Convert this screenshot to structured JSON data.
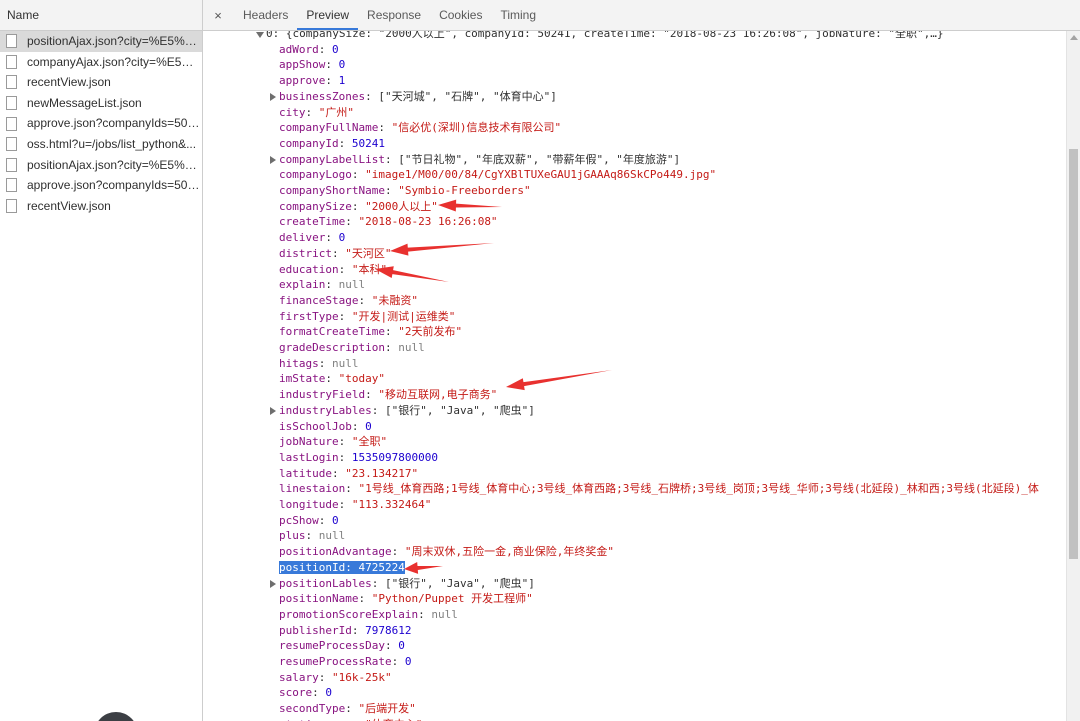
{
  "left_panel": {
    "header": "Name",
    "files": [
      {
        "name": "positionAjax.json?city=%E5%B...",
        "selected": true
      },
      {
        "name": "companyAjax.json?city=%E5%..."
      },
      {
        "name": "recentView.json"
      },
      {
        "name": "newMessageList.json"
      },
      {
        "name": "approve.json?companyIds=502..."
      },
      {
        "name": "oss.html?u=/jobs/list_python&..."
      },
      {
        "name": "positionAjax.json?city=%E5%B..."
      },
      {
        "name": "approve.json?companyIds=502..."
      },
      {
        "name": "recentView.json"
      }
    ]
  },
  "tabs": {
    "close": "×",
    "items": [
      {
        "label": "Headers"
      },
      {
        "label": "Preview",
        "active": true
      },
      {
        "label": "Response"
      },
      {
        "label": "Cookies"
      },
      {
        "label": "Timing"
      }
    ]
  },
  "preview": {
    "summary": "0: {companySize: \"2000人以上\", companyId: 50241, createTime: \"2018-08-23 16:26:08\", jobNature: \"全职\",…}",
    "fields": [
      {
        "key": "adWord",
        "value": "0",
        "type": "num"
      },
      {
        "key": "appShow",
        "value": "0",
        "type": "num"
      },
      {
        "key": "approve",
        "value": "1",
        "type": "num"
      },
      {
        "key": "businessZones",
        "value": "[\"天河城\", \"石牌\", \"体育中心\"]",
        "type": "arr",
        "expandable": true
      },
      {
        "key": "city",
        "value": "\"广州\"",
        "type": "str"
      },
      {
        "key": "companyFullName",
        "value": "\"信必优(深圳)信息技术有限公司\"",
        "type": "str"
      },
      {
        "key": "companyId",
        "value": "50241",
        "type": "num"
      },
      {
        "key": "companyLabelList",
        "value": "[\"节日礼物\", \"年底双薪\", \"带薪年假\", \"年度旅游\"]",
        "type": "arr",
        "expandable": true
      },
      {
        "key": "companyLogo",
        "value": "\"image1/M00/00/84/CgYXBlTUXeGAU1jGAAAq86SkCPo449.jpg\"",
        "type": "str"
      },
      {
        "key": "companyShortName",
        "value": "\"Symbio-Freeborders\"",
        "type": "str"
      },
      {
        "key": "companySize",
        "value": "\"2000人以上\"",
        "type": "str"
      },
      {
        "key": "createTime",
        "value": "\"2018-08-23 16:26:08\"",
        "type": "str"
      },
      {
        "key": "deliver",
        "value": "0",
        "type": "num"
      },
      {
        "key": "district",
        "value": "\"天河区\"",
        "type": "str"
      },
      {
        "key": "education",
        "value": "\"本科\"",
        "type": "str"
      },
      {
        "key": "explain",
        "value": "null",
        "type": "null"
      },
      {
        "key": "financeStage",
        "value": "\"未融资\"",
        "type": "str"
      },
      {
        "key": "firstType",
        "value": "\"开发|测试|运维类\"",
        "type": "str"
      },
      {
        "key": "formatCreateTime",
        "value": "\"2天前发布\"",
        "type": "str"
      },
      {
        "key": "gradeDescription",
        "value": "null",
        "type": "null"
      },
      {
        "key": "hitags",
        "value": "null",
        "type": "null"
      },
      {
        "key": "imState",
        "value": "\"today\"",
        "type": "str"
      },
      {
        "key": "industryField",
        "value": "\"移动互联网,电子商务\"",
        "type": "str"
      },
      {
        "key": "industryLables",
        "value": "[\"银行\", \"Java\", \"爬虫\"]",
        "type": "arr",
        "expandable": true
      },
      {
        "key": "isSchoolJob",
        "value": "0",
        "type": "num"
      },
      {
        "key": "jobNature",
        "value": "\"全职\"",
        "type": "str"
      },
      {
        "key": "lastLogin",
        "value": "1535097800000",
        "type": "num"
      },
      {
        "key": "latitude",
        "value": "\"23.134217\"",
        "type": "str"
      },
      {
        "key": "linestaion",
        "value": "\"1号线_体育西路;1号线_体育中心;3号线_体育西路;3号线_石牌桥;3号线_岗顶;3号线_华师;3号线(北延段)_林和西;3号线(北延段)_体",
        "type": "str"
      },
      {
        "key": "longitude",
        "value": "\"113.332464\"",
        "type": "str"
      },
      {
        "key": "pcShow",
        "value": "0",
        "type": "num"
      },
      {
        "key": "plus",
        "value": "null",
        "type": "null"
      },
      {
        "key": "positionAdvantage",
        "value": "\"周末双休,五险一金,商业保险,年终奖金\"",
        "type": "str"
      },
      {
        "key": "positionId",
        "value": "4725224",
        "type": "num",
        "selected": true
      },
      {
        "key": "positionLables",
        "value": "[\"银行\", \"Java\", \"爬虫\"]",
        "type": "arr",
        "expandable": true
      },
      {
        "key": "positionName",
        "value": "\"Python/Puppet 开发工程师\"",
        "type": "str"
      },
      {
        "key": "promotionScoreExplain",
        "value": "null",
        "type": "null"
      },
      {
        "key": "publisherId",
        "value": "7978612",
        "type": "num"
      },
      {
        "key": "resumeProcessDay",
        "value": "0",
        "type": "num"
      },
      {
        "key": "resumeProcessRate",
        "value": "0",
        "type": "num"
      },
      {
        "key": "salary",
        "value": "\"16k-25k\"",
        "type": "str"
      },
      {
        "key": "score",
        "value": "0",
        "type": "num"
      },
      {
        "key": "secondType",
        "value": "\"后端开发\"",
        "type": "str"
      },
      {
        "key": "stationname",
        "value": "\"体育中心\"",
        "type": "str"
      }
    ]
  },
  "colors": {
    "key": "#881280",
    "string": "#c41a16",
    "number": "#1c00cf",
    "null": "#808080",
    "annotation_arrow": "#e8312f",
    "selection": "#3879d9"
  }
}
